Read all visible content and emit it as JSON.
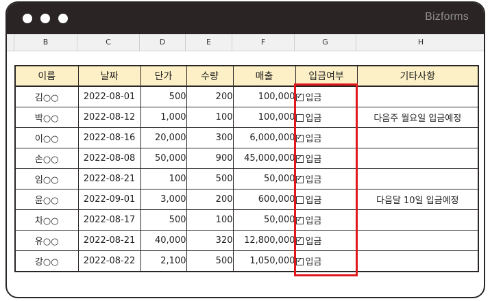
{
  "window": {
    "brand": "Bizforms"
  },
  "column_headers": [
    "B",
    "C",
    "D",
    "E",
    "F",
    "G",
    "H"
  ],
  "table": {
    "headers": [
      "이름",
      "날짜",
      "단가",
      "수량",
      "매출",
      "입금여부",
      "기타사항"
    ],
    "rows": [
      {
        "name": "김○○",
        "date": "2022-08-01",
        "price": "500",
        "qty": "200",
        "sales": "100,000",
        "paid": true,
        "paid_label": "입금",
        "note": ""
      },
      {
        "name": "박○○",
        "date": "2022-08-12",
        "price": "1,000",
        "qty": "100",
        "sales": "100,000",
        "paid": false,
        "paid_label": "입금",
        "note": "다음주 월요일 입금예정"
      },
      {
        "name": "이○○",
        "date": "2022-08-16",
        "price": "20,000",
        "qty": "300",
        "sales": "6,000,000",
        "paid": true,
        "paid_label": "입금",
        "note": ""
      },
      {
        "name": "손○○",
        "date": "2022-08-08",
        "price": "50,000",
        "qty": "900",
        "sales": "45,000,000",
        "paid": true,
        "paid_label": "입금",
        "note": ""
      },
      {
        "name": "임○○",
        "date": "2022-08-21",
        "price": "100",
        "qty": "500",
        "sales": "50,000",
        "paid": true,
        "paid_label": "입금",
        "note": ""
      },
      {
        "name": "윤○○",
        "date": "2022-09-01",
        "price": "3,000",
        "qty": "200",
        "sales": "600,000",
        "paid": false,
        "paid_label": "입금",
        "note": "다음달 10일 입금예정"
      },
      {
        "name": "차○○",
        "date": "2022-08-17",
        "price": "500",
        "qty": "100",
        "sales": "50,000",
        "paid": true,
        "paid_label": "입금",
        "note": ""
      },
      {
        "name": "유○○",
        "date": "2022-08-21",
        "price": "40,000",
        "qty": "320",
        "sales": "12,800,000",
        "paid": true,
        "paid_label": "입금",
        "note": ""
      },
      {
        "name": "강○○",
        "date": "2022-08-22",
        "price": "2,100",
        "qty": "500",
        "sales": "1,050,000",
        "paid": true,
        "paid_label": "입금",
        "note": ""
      }
    ]
  },
  "colors": {
    "header_fill": "#fdf0c6",
    "highlight": "#e0161b",
    "titlebar": "#2b2424"
  }
}
